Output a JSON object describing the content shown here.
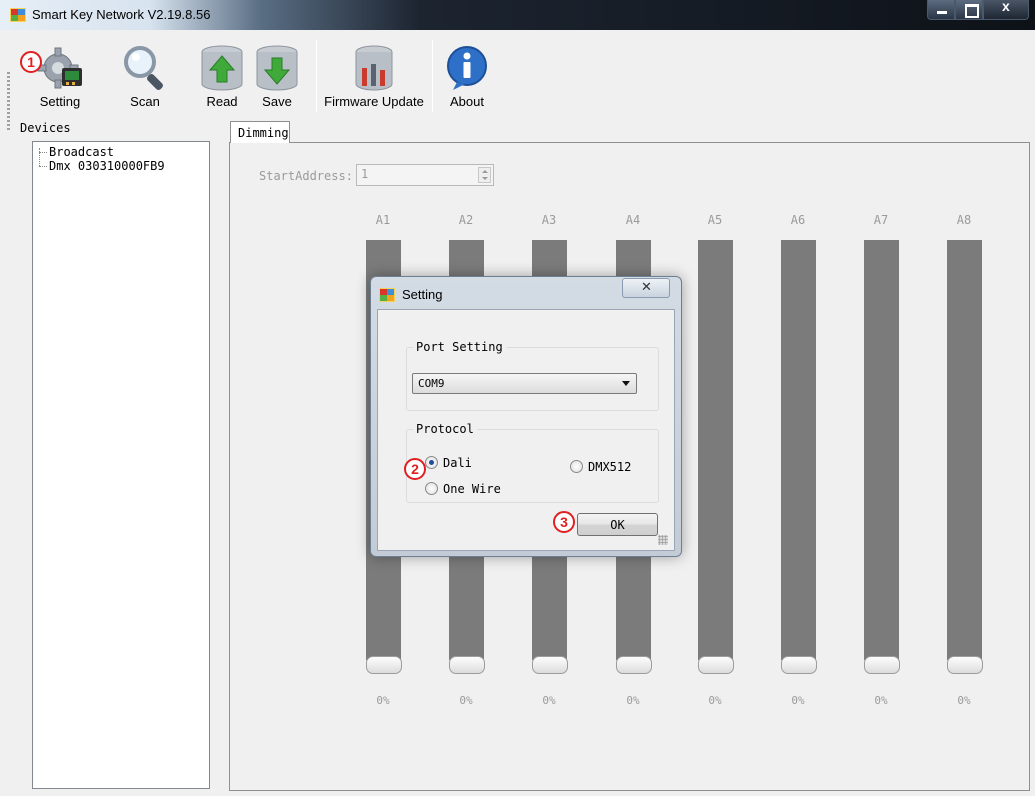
{
  "window": {
    "title": "Smart Key Network V2.19.8.56"
  },
  "toolbar": {
    "items": [
      {
        "label": "Setting",
        "icon": "gear-icon"
      },
      {
        "label": "Scan",
        "icon": "magnifier-icon"
      },
      {
        "label": "Read",
        "icon": "database-up-icon"
      },
      {
        "label": "Save",
        "icon": "database-down-icon"
      },
      {
        "label": "Firmware Update",
        "icon": "firmware-update-icon"
      },
      {
        "label": "About",
        "icon": "info-icon"
      }
    ]
  },
  "markers": [
    "1",
    "2",
    "3"
  ],
  "devices": {
    "label": "Devices",
    "items": [
      "Broadcast",
      "Dmx 030310000FB9"
    ]
  },
  "tabs": [
    {
      "label": "Dimming"
    }
  ],
  "dimming": {
    "start_address_label": "StartAddress:",
    "start_address_value": "1",
    "channels": [
      {
        "name": "A1",
        "level": "0%"
      },
      {
        "name": "A2",
        "level": "0%"
      },
      {
        "name": "A3",
        "level": "0%"
      },
      {
        "name": "A4",
        "level": "0%"
      },
      {
        "name": "A5",
        "level": "0%"
      },
      {
        "name": "A6",
        "level": "0%"
      },
      {
        "name": "A7",
        "level": "0%"
      },
      {
        "name": "A8",
        "level": "0%"
      }
    ]
  },
  "dialog": {
    "title": "Setting",
    "port_group": "Port Setting",
    "port_value": "COM9",
    "protocol_group": "Protocol",
    "protocols": [
      {
        "label": "Dali",
        "selected": true
      },
      {
        "label": "DMX512",
        "selected": false
      },
      {
        "label": "One Wire",
        "selected": false
      }
    ],
    "ok_label": "OK"
  },
  "colors": {
    "bar": "#7b7b7b",
    "marker": "#e02020",
    "radio_dot": "#1e4f9c"
  }
}
